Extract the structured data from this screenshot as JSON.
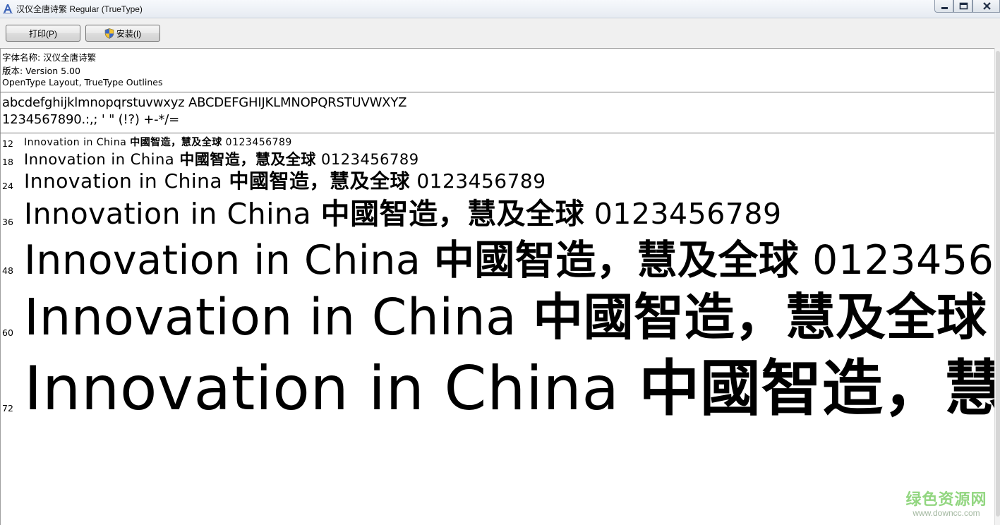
{
  "window": {
    "title": "汉仪全唐诗繁 Regular (TrueType)"
  },
  "toolbar": {
    "print_label": "打印(P)",
    "install_label": "安装(I)"
  },
  "font_info": {
    "name_line": "字体名称: 汉仪全唐诗繁",
    "version_line": "版本: Version 5.00",
    "type_line": "OpenType Layout, TrueType Outlines"
  },
  "charset": {
    "letters": "abcdefghijklmnopqrstuvwxyz ABCDEFGHIJKLMNOPQRSTUVWXYZ",
    "digits": "1234567890.:,; ' \" (!?) +-*/="
  },
  "samples": [
    {
      "size": "12",
      "latin": "Innovation in China ",
      "cjk": "中國智造，慧及全球",
      "tail": " 0123456789"
    },
    {
      "size": "18",
      "latin": "Innovation in China ",
      "cjk": "中國智造，慧及全球",
      "tail": " 0123456789"
    },
    {
      "size": "24",
      "latin": "Innovation in China ",
      "cjk": "中國智造，慧及全球",
      "tail": " 0123456789"
    },
    {
      "size": "36",
      "latin": "Innovation in China ",
      "cjk": "中國智造，慧及全球",
      "tail": " 0123456789"
    },
    {
      "size": "48",
      "latin": "Innovation in China ",
      "cjk": "中國智造，慧及全球",
      "tail": " 0123456"
    },
    {
      "size": "60",
      "latin": "Innovation in China ",
      "cjk": "中國智造，慧及全球",
      "tail": ""
    },
    {
      "size": "72",
      "latin": "Innovation in China ",
      "cjk": "中國智造，慧",
      "tail": ""
    }
  ],
  "watermark": {
    "main": "绿色资源网",
    "sub": "www.downcc.com"
  },
  "colors": {
    "watermark_green": "#7fcf6a",
    "toolbar_bg": "#f0f0f0"
  },
  "icons": {
    "app": "font-app-icon",
    "install": "uac-shield-icon"
  }
}
